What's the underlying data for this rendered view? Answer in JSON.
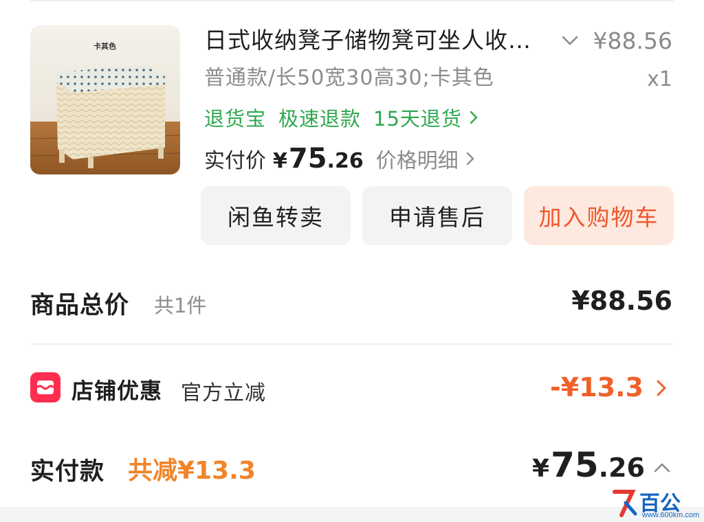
{
  "product": {
    "title": "日式收纳凳子储物凳可坐人收…",
    "unit_price": "¥88.56",
    "sku": "普通款/长50宽30高30;卡其色",
    "quantity": "x1",
    "thumbnail_label": "卡其色",
    "services": [
      "退货宝",
      "极速退款",
      "15天退货"
    ],
    "paid_price_label": "实付价",
    "paid_price_symbol": "¥",
    "paid_price_int": "75",
    "paid_price_dec": ".26",
    "price_detail_label": "价格明细"
  },
  "actions": {
    "resell": "闲鱼转卖",
    "aftersale": "申请售后",
    "add_to_cart": "加入购物车"
  },
  "summary": {
    "total_label": "商品总价",
    "total_count": "共1件",
    "total_value": "¥88.56",
    "store_discount_label": "店铺优惠",
    "store_discount_desc": "官方立减",
    "store_discount_value": "-¥13.3",
    "pay_label": "实付款",
    "pay_saved": "共减¥13.3",
    "pay_symbol": "¥",
    "pay_int": "75",
    "pay_dec": ".26"
  },
  "watermark": {
    "text": "百公里",
    "url": "www.600km.com"
  },
  "colors": {
    "service_green": "#2ea84f",
    "discount_orange": "#f0612a",
    "cart_button_bg": "#fde9df",
    "store_icon_red": "#ff2d4f"
  }
}
